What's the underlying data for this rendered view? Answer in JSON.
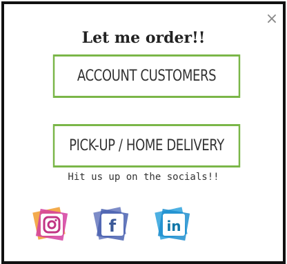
{
  "dialog": {
    "close_glyph": "×",
    "title": "Let me order!!",
    "buttons": {
      "account_label": "ACCOUNT CUSTOMERS",
      "pickup_label": "PICK-UP / HOME DELIVERY"
    },
    "socials_prompt": "Hit us up on the socials!!",
    "socials": [
      {
        "name": "instagram-icon",
        "glyph": "◎"
      },
      {
        "name": "facebook-icon",
        "glyph": "f"
      },
      {
        "name": "linkedin-icon",
        "glyph": "in"
      }
    ]
  },
  "colors": {
    "border": "#111111",
    "button_border": "#7ab648",
    "close": "#8a8a8a",
    "instagram_a": "#f2a23a",
    "instagram_b": "#d43fa0",
    "facebook": "#4a62b0",
    "linkedin": "#1f8fcf"
  }
}
